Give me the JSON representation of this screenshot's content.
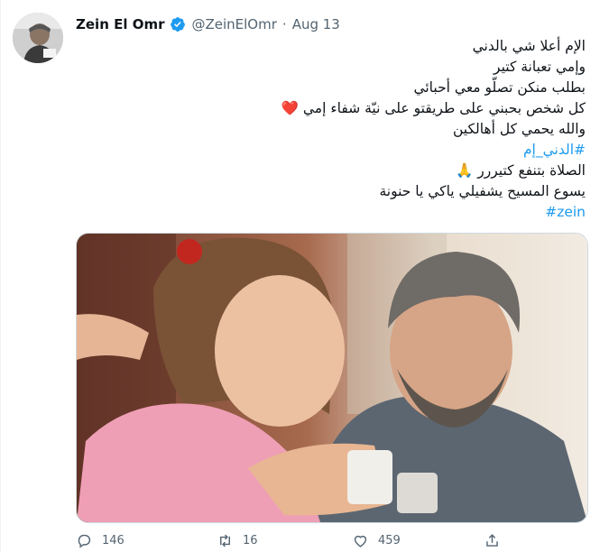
{
  "tweet": {
    "author_name": "Zein El Omr",
    "handle": "@ZeinElOmr",
    "separator": "·",
    "date": "Aug 13",
    "lines": [
      "الإم أعلا شي بالدني",
      "وإمي تعبانة  كتير",
      "بطلب منكن تصلّو معي أحبائي",
      "كل شخص بحبني على طريقتو على نيّة شفاء إمي",
      "والله يحمي كل أهالكين",
      "#الدني_إم",
      "الصلاة بتنفع كتيررر",
      "يسوع المسيح يشفيلي ياكي يا حنونة",
      "#zein"
    ],
    "emoji": {
      "heart": "❤️",
      "praying_hands": "🙏"
    }
  },
  "actions": {
    "reply_count": "146",
    "retweet_count": "16",
    "like_count": "459"
  },
  "colors": {
    "link": "#1d9bf0",
    "muted": "#536471",
    "heart": "#f91880",
    "verified": "#1d9bf0"
  }
}
